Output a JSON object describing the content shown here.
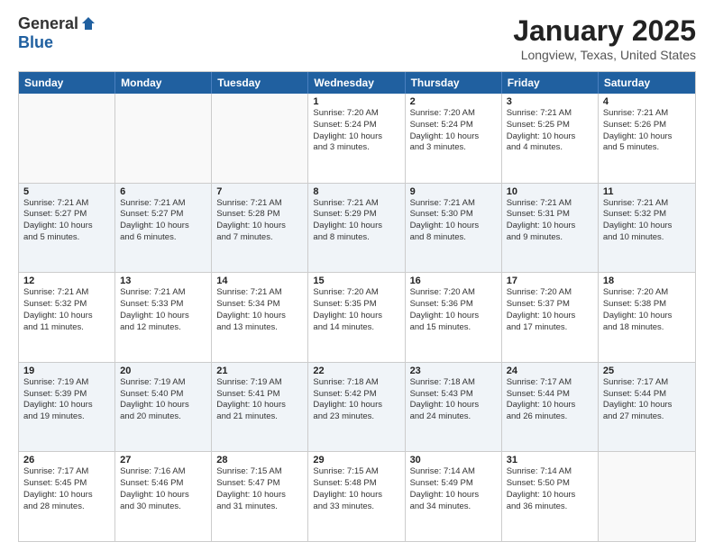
{
  "header": {
    "logo_general": "General",
    "logo_blue": "Blue",
    "month": "January 2025",
    "location": "Longview, Texas, United States"
  },
  "days_of_week": [
    "Sunday",
    "Monday",
    "Tuesday",
    "Wednesday",
    "Thursday",
    "Friday",
    "Saturday"
  ],
  "weeks": [
    [
      {
        "num": "",
        "info": ""
      },
      {
        "num": "",
        "info": ""
      },
      {
        "num": "",
        "info": ""
      },
      {
        "num": "1",
        "info": "Sunrise: 7:20 AM\nSunset: 5:24 PM\nDaylight: 10 hours\nand 3 minutes."
      },
      {
        "num": "2",
        "info": "Sunrise: 7:20 AM\nSunset: 5:24 PM\nDaylight: 10 hours\nand 3 minutes."
      },
      {
        "num": "3",
        "info": "Sunrise: 7:21 AM\nSunset: 5:25 PM\nDaylight: 10 hours\nand 4 minutes."
      },
      {
        "num": "4",
        "info": "Sunrise: 7:21 AM\nSunset: 5:26 PM\nDaylight: 10 hours\nand 5 minutes."
      }
    ],
    [
      {
        "num": "5",
        "info": "Sunrise: 7:21 AM\nSunset: 5:27 PM\nDaylight: 10 hours\nand 5 minutes."
      },
      {
        "num": "6",
        "info": "Sunrise: 7:21 AM\nSunset: 5:27 PM\nDaylight: 10 hours\nand 6 minutes."
      },
      {
        "num": "7",
        "info": "Sunrise: 7:21 AM\nSunset: 5:28 PM\nDaylight: 10 hours\nand 7 minutes."
      },
      {
        "num": "8",
        "info": "Sunrise: 7:21 AM\nSunset: 5:29 PM\nDaylight: 10 hours\nand 8 minutes."
      },
      {
        "num": "9",
        "info": "Sunrise: 7:21 AM\nSunset: 5:30 PM\nDaylight: 10 hours\nand 8 minutes."
      },
      {
        "num": "10",
        "info": "Sunrise: 7:21 AM\nSunset: 5:31 PM\nDaylight: 10 hours\nand 9 minutes."
      },
      {
        "num": "11",
        "info": "Sunrise: 7:21 AM\nSunset: 5:32 PM\nDaylight: 10 hours\nand 10 minutes."
      }
    ],
    [
      {
        "num": "12",
        "info": "Sunrise: 7:21 AM\nSunset: 5:32 PM\nDaylight: 10 hours\nand 11 minutes."
      },
      {
        "num": "13",
        "info": "Sunrise: 7:21 AM\nSunset: 5:33 PM\nDaylight: 10 hours\nand 12 minutes."
      },
      {
        "num": "14",
        "info": "Sunrise: 7:21 AM\nSunset: 5:34 PM\nDaylight: 10 hours\nand 13 minutes."
      },
      {
        "num": "15",
        "info": "Sunrise: 7:20 AM\nSunset: 5:35 PM\nDaylight: 10 hours\nand 14 minutes."
      },
      {
        "num": "16",
        "info": "Sunrise: 7:20 AM\nSunset: 5:36 PM\nDaylight: 10 hours\nand 15 minutes."
      },
      {
        "num": "17",
        "info": "Sunrise: 7:20 AM\nSunset: 5:37 PM\nDaylight: 10 hours\nand 17 minutes."
      },
      {
        "num": "18",
        "info": "Sunrise: 7:20 AM\nSunset: 5:38 PM\nDaylight: 10 hours\nand 18 minutes."
      }
    ],
    [
      {
        "num": "19",
        "info": "Sunrise: 7:19 AM\nSunset: 5:39 PM\nDaylight: 10 hours\nand 19 minutes."
      },
      {
        "num": "20",
        "info": "Sunrise: 7:19 AM\nSunset: 5:40 PM\nDaylight: 10 hours\nand 20 minutes."
      },
      {
        "num": "21",
        "info": "Sunrise: 7:19 AM\nSunset: 5:41 PM\nDaylight: 10 hours\nand 21 minutes."
      },
      {
        "num": "22",
        "info": "Sunrise: 7:18 AM\nSunset: 5:42 PM\nDaylight: 10 hours\nand 23 minutes."
      },
      {
        "num": "23",
        "info": "Sunrise: 7:18 AM\nSunset: 5:43 PM\nDaylight: 10 hours\nand 24 minutes."
      },
      {
        "num": "24",
        "info": "Sunrise: 7:17 AM\nSunset: 5:44 PM\nDaylight: 10 hours\nand 26 minutes."
      },
      {
        "num": "25",
        "info": "Sunrise: 7:17 AM\nSunset: 5:44 PM\nDaylight: 10 hours\nand 27 minutes."
      }
    ],
    [
      {
        "num": "26",
        "info": "Sunrise: 7:17 AM\nSunset: 5:45 PM\nDaylight: 10 hours\nand 28 minutes."
      },
      {
        "num": "27",
        "info": "Sunrise: 7:16 AM\nSunset: 5:46 PM\nDaylight: 10 hours\nand 30 minutes."
      },
      {
        "num": "28",
        "info": "Sunrise: 7:15 AM\nSunset: 5:47 PM\nDaylight: 10 hours\nand 31 minutes."
      },
      {
        "num": "29",
        "info": "Sunrise: 7:15 AM\nSunset: 5:48 PM\nDaylight: 10 hours\nand 33 minutes."
      },
      {
        "num": "30",
        "info": "Sunrise: 7:14 AM\nSunset: 5:49 PM\nDaylight: 10 hours\nand 34 minutes."
      },
      {
        "num": "31",
        "info": "Sunrise: 7:14 AM\nSunset: 5:50 PM\nDaylight: 10 hours\nand 36 minutes."
      },
      {
        "num": "",
        "info": ""
      }
    ]
  ]
}
